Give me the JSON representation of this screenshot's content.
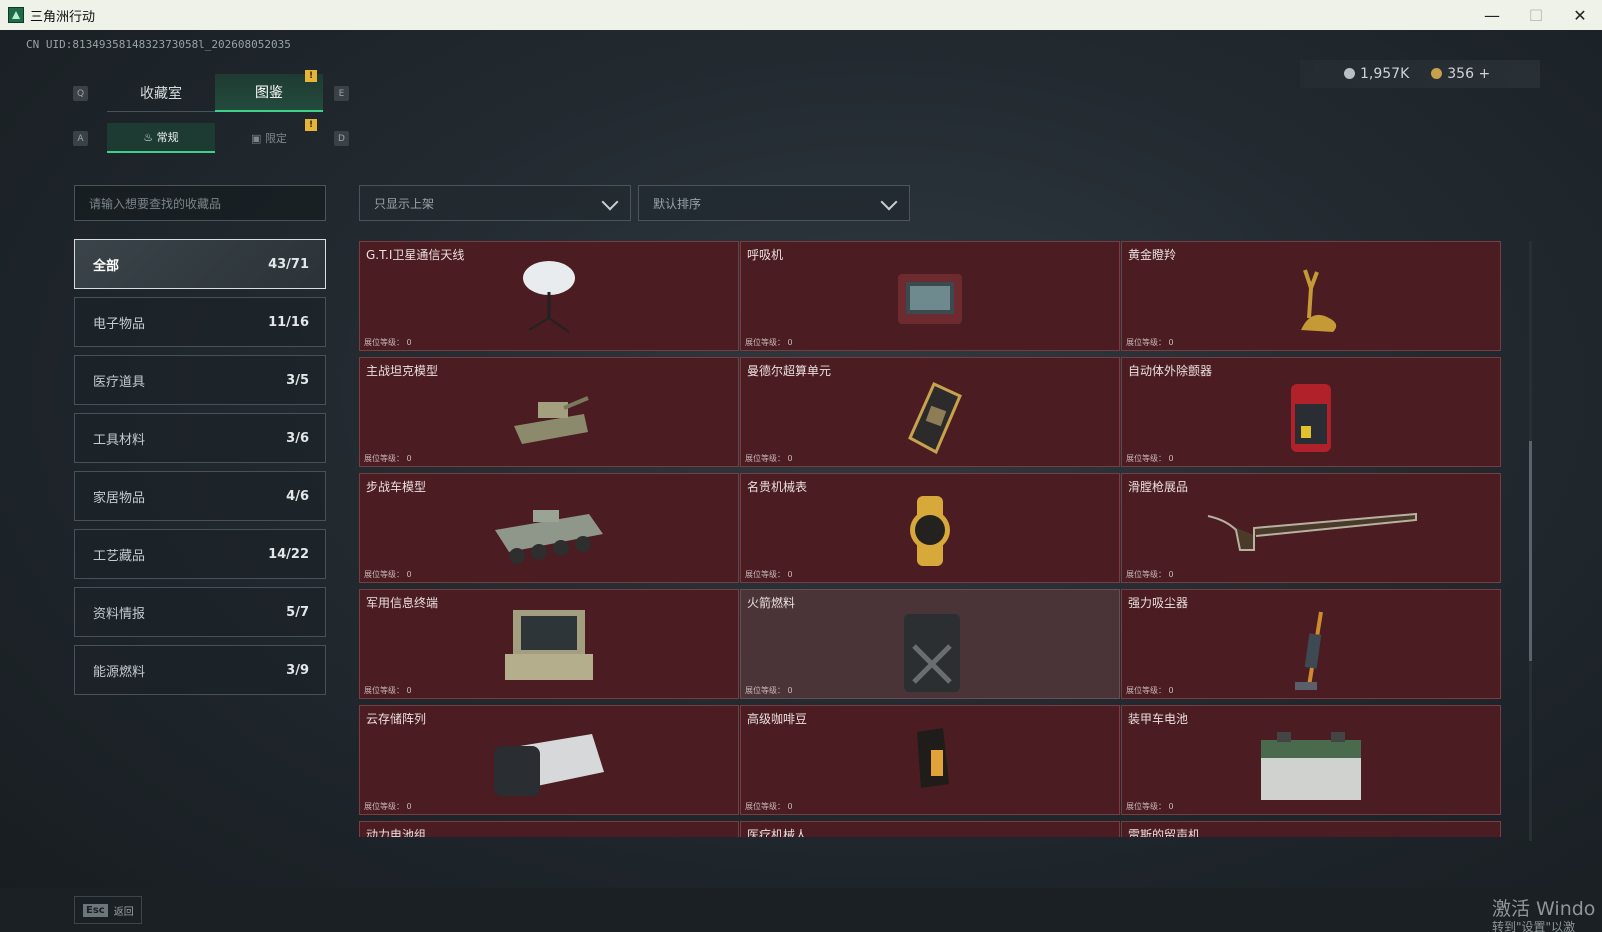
{
  "window": {
    "title": "三角洲行动",
    "icon": "delta-force-app-icon"
  },
  "uid_text": "CN UID:8134935814832373058l_202608052035",
  "currency": {
    "silver": "1,957K",
    "gold": "356",
    "add": "+"
  },
  "hotkeys": {
    "q": "Q",
    "e": "E",
    "a": "A",
    "d": "D"
  },
  "tabs": [
    {
      "label": "收藏室"
    },
    {
      "label": "图鉴"
    }
  ],
  "subtabs": [
    {
      "label": "常规",
      "icon": "flame-icon"
    },
    {
      "label": "限定",
      "icon": "image-icon"
    }
  ],
  "badge": "!",
  "search": {
    "placeholder": "请输入想要查找的收藏品"
  },
  "filters": {
    "shelf": "只显示上架",
    "sort": "默认排序"
  },
  "categories": [
    {
      "label": "全部",
      "count": "43/71"
    },
    {
      "label": "电子物品",
      "count": "11/16"
    },
    {
      "label": "医疗道具",
      "count": "3/5"
    },
    {
      "label": "工具材料",
      "count": "3/6"
    },
    {
      "label": "家居物品",
      "count": "4/6"
    },
    {
      "label": "工艺藏品",
      "count": "14/22"
    },
    {
      "label": "资料情报",
      "count": "5/7"
    },
    {
      "label": "能源燃料",
      "count": "3/9"
    }
  ],
  "level_label": "展位等级：",
  "items": [
    {
      "name": "G.T.I卫星通信天线",
      "level": "0",
      "icon": "satellite-dish-icon"
    },
    {
      "name": "呼吸机",
      "level": "0",
      "icon": "ventilator-icon"
    },
    {
      "name": "黄金瞪羚",
      "level": "0",
      "icon": "golden-gazelle-icon"
    },
    {
      "name": "主战坦克模型",
      "level": "0",
      "icon": "tank-model-icon"
    },
    {
      "name": "曼德尔超算单元",
      "level": "0",
      "icon": "supercomputer-unit-icon"
    },
    {
      "name": "自动体外除颤器",
      "level": "0",
      "icon": "defibrillator-icon"
    },
    {
      "name": "步战车模型",
      "level": "0",
      "icon": "ifv-model-icon"
    },
    {
      "name": "名贵机械表",
      "level": "0",
      "icon": "watch-icon"
    },
    {
      "name": "滑膛枪展品",
      "level": "0",
      "icon": "musket-icon"
    },
    {
      "name": "军用信息终端",
      "level": "0",
      "icon": "military-terminal-icon"
    },
    {
      "name": "火箭燃料",
      "level": "0",
      "icon": "fuel-can-icon"
    },
    {
      "name": "强力吸尘器",
      "level": "0",
      "icon": "vacuum-cleaner-icon"
    },
    {
      "name": "云存储阵列",
      "level": "0",
      "icon": "storage-array-icon"
    },
    {
      "name": "高级咖啡豆",
      "level": "0",
      "icon": "coffee-bag-icon"
    },
    {
      "name": "装甲车电池",
      "level": "0",
      "icon": "battery-icon"
    },
    {
      "name": "动力电池组",
      "level": "",
      "icon": ""
    },
    {
      "name": "医疗机械人",
      "level": "",
      "icon": ""
    },
    {
      "name": "雷斯的留声机",
      "level": "",
      "icon": ""
    }
  ],
  "footer": {
    "esc_key": "Esc",
    "back": "返回"
  },
  "watermark": {
    "line1": "激活 Windo",
    "line2": "转到\"设置\"以激"
  },
  "colors": {
    "accent": "#3fd08a",
    "card_bg": "#4b1c21",
    "card_border": "#7a3b41",
    "badge": "#e7b43a"
  }
}
